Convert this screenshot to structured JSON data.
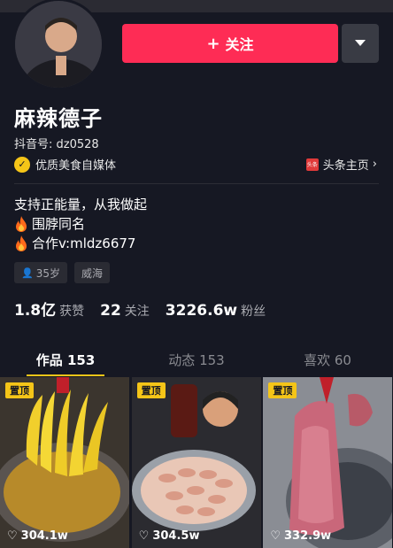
{
  "profile": {
    "name": "麻辣德子",
    "douyin_id": "抖音号: dz0528",
    "certification": "优质美食自媒体",
    "toutiao_link": "头条主页",
    "toutiao_icon": "头条"
  },
  "actions": {
    "follow_label": "关注",
    "follow_plus": "+"
  },
  "bio": {
    "lines": [
      "支持正能量，从我做起",
      "围脖同名",
      "合作v:mldz6677"
    ]
  },
  "tags": {
    "age": "35岁",
    "location": "威海"
  },
  "stats": {
    "likes_value": "1.8亿",
    "likes_label": "获赞",
    "following_value": "22",
    "following_label": "关注",
    "followers_value": "3226.6w",
    "followers_label": "粉丝"
  },
  "tabs": [
    {
      "label": "作品 153",
      "active": true
    },
    {
      "label": "动态 153",
      "active": false
    },
    {
      "label": "喜欢 60",
      "active": false
    }
  ],
  "videos": [
    {
      "pin_label": "置顶",
      "likes": "304.1w",
      "subject": "bananas in pan"
    },
    {
      "pin_label": "置顶",
      "likes": "304.5w",
      "subject": "chicken wings tray"
    },
    {
      "pin_label": "置顶",
      "likes": "332.9w",
      "subject": "pork slab"
    }
  ],
  "colors": {
    "background": "#161823",
    "follow_button": "#fe2c55",
    "accent_yellow": "#f5c518"
  },
  "icons": [
    "chevron-down-icon",
    "cert-badge-icon",
    "toutiao-icon",
    "chevron-right-icon",
    "fire-icon",
    "person-icon",
    "heart-icon"
  ]
}
